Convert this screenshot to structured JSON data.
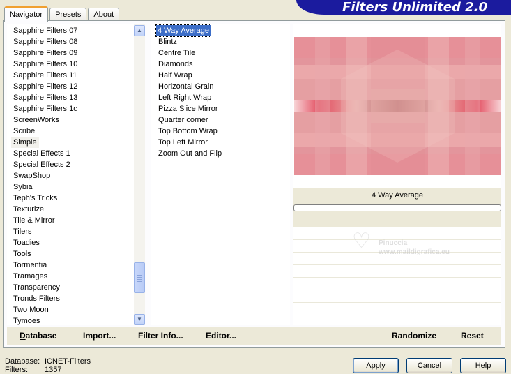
{
  "tabs": [
    {
      "label": "Navigator",
      "active": true
    },
    {
      "label": "Presets",
      "active": false
    },
    {
      "label": "About",
      "active": false
    }
  ],
  "banner": {
    "title": "Filters Unlimited 2.0",
    "color": "#1b1b9e"
  },
  "categories": [
    "Sapphire Filters 07",
    "Sapphire Filters 08",
    "Sapphire Filters 09",
    "Sapphire Filters 10",
    "Sapphire Filters 11",
    "Sapphire Filters 12",
    "Sapphire Filters 13",
    "Sapphire Filters 1c",
    "ScreenWorks",
    "Scribe",
    "Simple",
    "Special Effects 1",
    "Special Effects 2",
    "SwapShop",
    "Sybia",
    "Teph's Tricks",
    "Texturize",
    "Tile & Mirror",
    "Tilers",
    "Toadies",
    "Tools",
    "Tormentia",
    "Tramages",
    "Transparency",
    "Tronds Filters",
    "Two Moon",
    "Tymoes"
  ],
  "selected_category": "Simple",
  "filters": [
    "4 Way Average",
    "Blintz",
    "Centre Tile",
    "Diamonds",
    "Half Wrap",
    "Horizontal Grain",
    "Left Right Wrap",
    "Pizza Slice Mirror",
    "Quarter corner",
    "Top Bottom Wrap",
    "Top Left Mirror",
    "Zoom Out and Flip"
  ],
  "selected_filter": "4 Way Average",
  "preview": {
    "filter_name": "4 Way Average"
  },
  "watermark": {
    "name": "Pinuccia",
    "url": "www.maildigrafica.eu"
  },
  "toolbar": {
    "database": "Database",
    "import": "Import...",
    "filter_info": "Filter Info...",
    "editor": "Editor...",
    "randomize": "Randomize",
    "reset": "Reset"
  },
  "info": {
    "database_label": "Database:",
    "database_value": "ICNET-Filters",
    "filters_label": "Filters:",
    "filters_value": "1357"
  },
  "buttons": {
    "apply": "Apply",
    "cancel": "Cancel",
    "help": "Help"
  },
  "colors": {
    "selection": "#3d6ec8",
    "window_bg": "#ece9d8"
  }
}
